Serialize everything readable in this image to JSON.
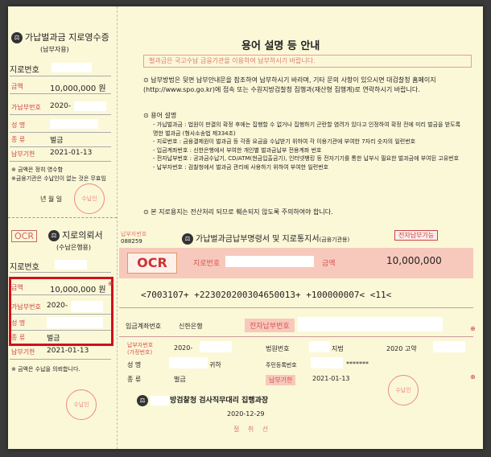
{
  "receipt": {
    "title": "가납벌과금 지로영수증",
    "subtitle": "(납부자용)",
    "payer_no_label": "지로번호",
    "amount_label": "금액",
    "amount": "10,000,000 원",
    "case_no_label": "가납부번호",
    "case_no": "2020-",
    "name_label": "성 명",
    "type_label": "종 류",
    "type": "벌금",
    "deadline_label": "납부기한",
    "deadline": "2021-01-13",
    "note1": "※ 금액은 정히 영수함",
    "note2": "※금융기관은 수납인이 없는 것은 무효임",
    "date_line": "년  월  일",
    "seal": "수납인"
  },
  "notice": {
    "title": "용어 설명 등 안내",
    "banner": "벌과금은 국고수납 금융기관을 이용하여 납부하시기 바랍니다.",
    "p1": "납부방법은 뒷면 납부안내문을 참조하여 납부하시기 바라며, 기타 문의 사항이 있으시면 대검찰청 홈페이지(http://www.spo.go.kr)에 접속 또는 수원지방검찰청 집행과(재산형 집행계)로 연락하시기 바랍니다.",
    "p2_title": "용어 설명",
    "items": [
      "- 가납벌과금 : 법원이 판결의 확정 후에는 집행할 수 없거나 집행하기 곤란할 염려가 있다고 인정하여 확정 전에 미리 벌금을 받도록 명한 벌과금 (형사소송법 제334조)",
      "- 지로번호 : 금융결제원이 벌과금 등 각종 요금을 수납받기 위하여 각 이용기관에 부여한 7자리 숫자의 일련번호",
      "- 입금계좌번호 : 신한은행에서 부여한 개인별 벌과금납부 전용계좌 번호",
      "- 전자납부번호 : 공과금수납기, CD/ATM(현금입출금기), 인터넷뱅킹 등 전자기기를 통한 납부시 필요한 벌과금에 부여된 고유번호",
      "- 납부자번호 : 검찰청에서 벌과금 관리에 사용하기 위하여 부여한 일련번호"
    ],
    "p3": "본 지로용지는 전산처리 되므로 훼손되지 않도록 주의하여야 합니다."
  },
  "stub2": {
    "ocr": "OCR",
    "title": "지로의뢰서",
    "subtitle": "(수납은행용)",
    "payer_no_label": "지로번호",
    "amount_label": "금액",
    "amount": "10,000,000 원",
    "case_no_label": "가납부번호",
    "case_no": "2020-",
    "name_label": "성 명",
    "type_label": "종 류",
    "type": "벌금",
    "deadline_label": "납부기한",
    "deadline": "2021-01-13",
    "note": "※ 금액은 수납을 의뢰합니다.",
    "seal": "수납인"
  },
  "main": {
    "code_label": "납부자번호",
    "code": "088259",
    "title": "가납벌과금납부명령서 및 지로통지서",
    "title_sub": "(금융기관용)",
    "badge": "전자납부가능",
    "ocr": "OCR",
    "payer_no_label": "지로번호",
    "amount_label": "금액",
    "amount": "10,000,000",
    "ocr_line": "<7003107+    +2230202003046500​13+   +100000007<  <11<",
    "account_label": "입금계좌번호",
    "bank": "신한은행",
    "epay_label": "전자납부번호",
    "case_no_label": "납부자번호",
    "case_no_sub": "(가정번호)",
    "case_no": "2020-",
    "court_label": "법원번호",
    "court": "지법",
    "court_case": "2020 고약",
    "name_label": "성 명",
    "name": "귀하",
    "id_label": "주민등록번호",
    "id": "*******",
    "type_label": "종 류",
    "type": "벌금",
    "deadline_label": "납부기한",
    "deadline": "2021-01-13",
    "issuer": "방검찰청 검사직무대리 집행과장",
    "issue_date": "2020-12-29",
    "stamp": "절 취 선",
    "seal": "수납인"
  },
  "colors": {
    "highlight": "#d0101a",
    "pink": "#f7c9bd",
    "paper": "#fbf8d8"
  }
}
